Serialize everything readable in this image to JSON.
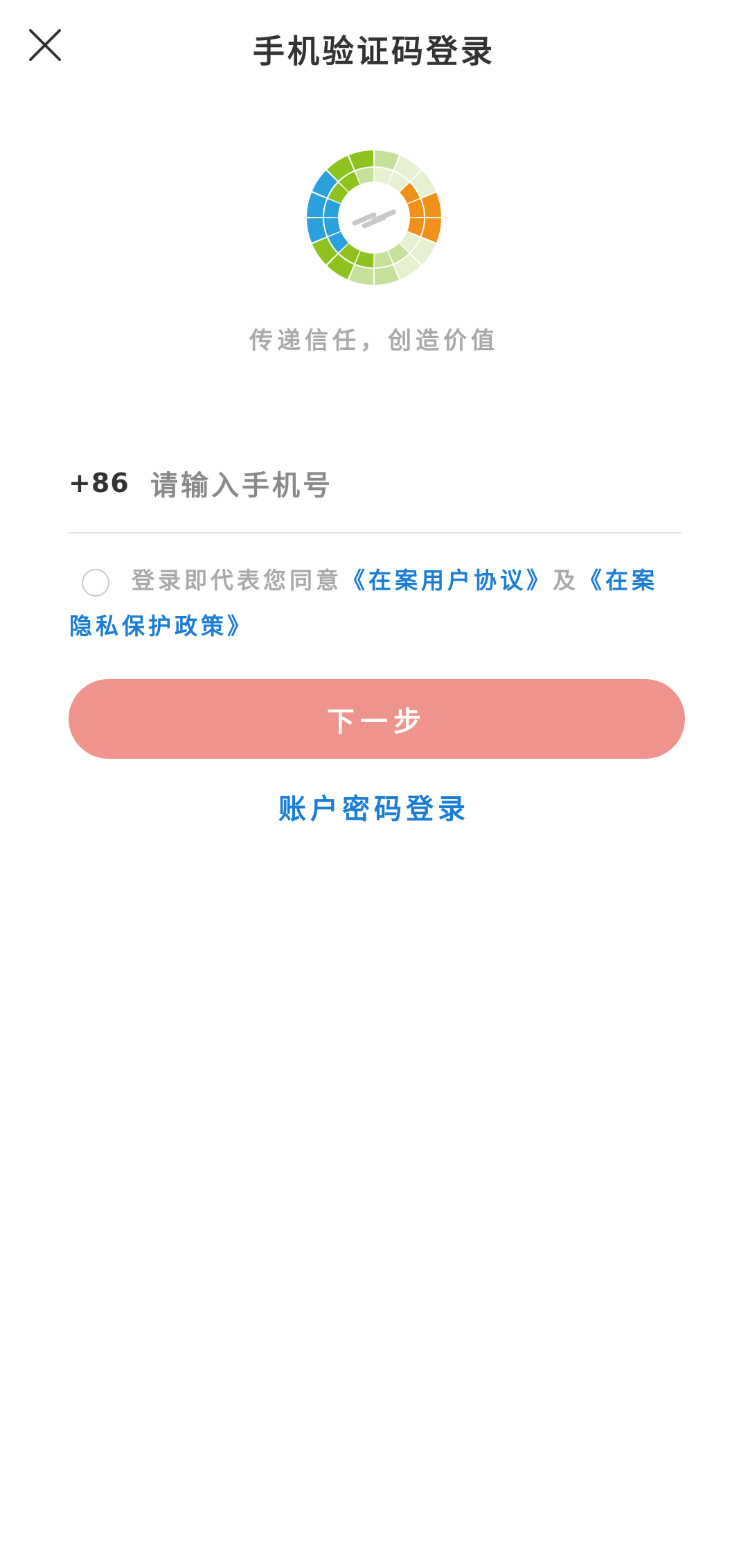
{
  "header": {
    "title": "手机验证码登录",
    "close_icon": "close-icon"
  },
  "brand": {
    "logo_icon": "ring-logo-icon",
    "slogan": "传递信任，创造价值",
    "colors": {
      "green": "#8dc21f",
      "light_green": "#c5e09a",
      "pale_green": "#e4f0d0",
      "orange": "#f0911c",
      "blue": "#2aa0dc",
      "gray": "#c8c8c8"
    }
  },
  "phone": {
    "country_code": "+86",
    "placeholder": "请输入手机号",
    "value": ""
  },
  "agreement": {
    "checked": false,
    "prefix": "登录即代表您同意",
    "user_agreement": "《在案用户协议》",
    "conjunction": "及",
    "privacy_policy": "《在案隐私保护政策》"
  },
  "actions": {
    "next_label": "下一步",
    "next_color": "#ee948d",
    "password_login_label": "账户密码登录",
    "link_color": "#1a7dd6"
  }
}
